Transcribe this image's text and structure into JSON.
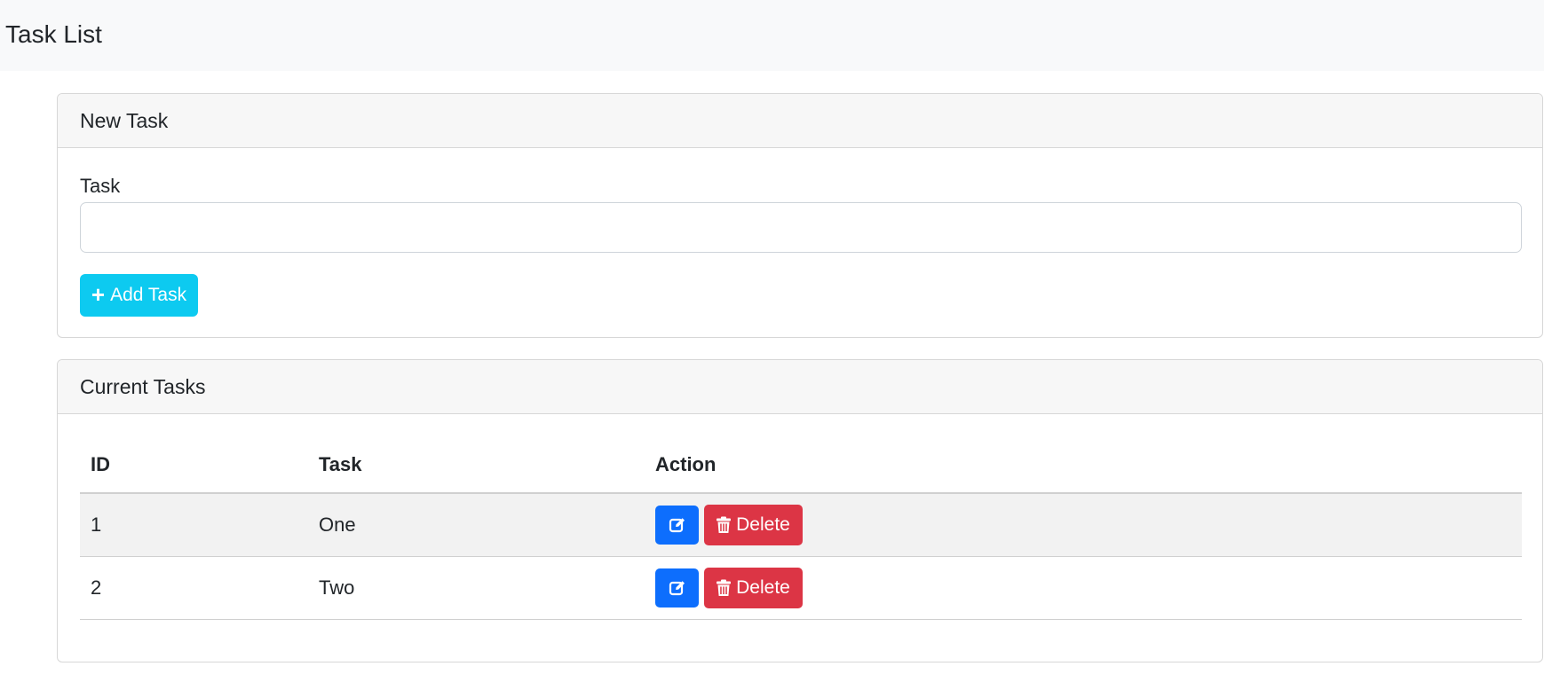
{
  "navbar": {
    "brand": "Task List"
  },
  "new_task": {
    "header": "New Task",
    "label": "Task",
    "input_value": "",
    "input_placeholder": "",
    "add_button_label": "Add Task",
    "add_button_icon": "plus-icon"
  },
  "current_tasks": {
    "header": "Current Tasks",
    "columns": [
      "ID",
      "Task",
      "Action"
    ],
    "rows": [
      {
        "id": "1",
        "task": "One",
        "delete_label": "Delete"
      },
      {
        "id": "2",
        "task": "Two",
        "delete_label": "Delete"
      }
    ],
    "edit_icon": "edit-icon",
    "delete_icon": "trash-icon"
  },
  "colors": {
    "navbar_bg": "#f8f9fa",
    "add_button": "#0dcaf0",
    "edit_button": "#0d6efd",
    "delete_button": "#dc3545"
  }
}
